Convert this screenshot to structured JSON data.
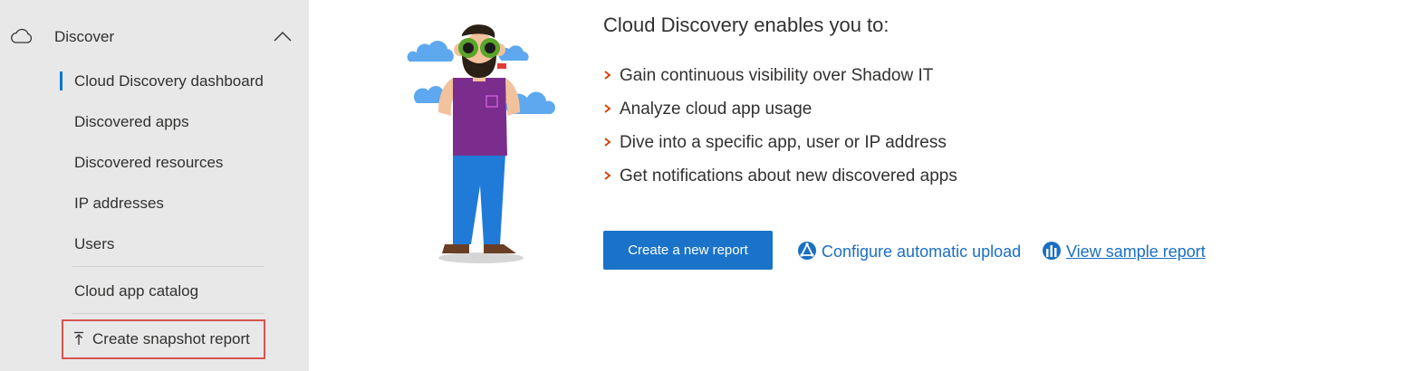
{
  "sidebar": {
    "section_title": "Discover",
    "items": [
      {
        "label": "Cloud Discovery dashboard",
        "active": true
      },
      {
        "label": "Discovered apps"
      },
      {
        "label": "Discovered resources"
      },
      {
        "label": "IP addresses"
      },
      {
        "label": "Users"
      },
      {
        "label": "Cloud app catalog"
      }
    ],
    "snapshot_label": "Create snapshot report"
  },
  "main": {
    "title": "Cloud Discovery enables you to:",
    "bullets": [
      "Gain continuous visibility over Shadow IT",
      "Analyze cloud app usage",
      "Dive into a specific app, user or IP address",
      "Get notifications about new discovered apps"
    ],
    "create_button_label": "Create a new report",
    "configure_link_label": "Configure automatic upload",
    "sample_link_label": "View sample report"
  },
  "colors": {
    "sidebar_bg": "#e8e8e8",
    "accent": "#0078d4",
    "button": "#1a73c8",
    "link": "#1a6fc2",
    "bullet_chevron": "#d83b01",
    "highlight_border": "#d9534f"
  },
  "icons": {
    "section": "cloud-icon",
    "collapse": "chevron-up-icon",
    "snapshot": "upload-arrow-icon",
    "configure": "configure-upload-icon",
    "sample": "bar-chart-icon"
  }
}
